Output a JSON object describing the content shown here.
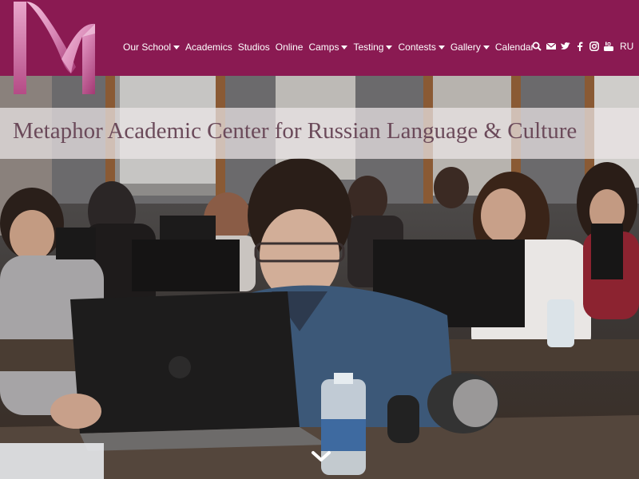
{
  "header": {
    "logo_letter": "M",
    "nav": [
      {
        "label": "Our School",
        "has_dropdown": true
      },
      {
        "label": "Academics",
        "has_dropdown": false
      },
      {
        "label": "Studios",
        "has_dropdown": false
      },
      {
        "label": "Online",
        "has_dropdown": false
      },
      {
        "label": "Camps",
        "has_dropdown": true
      },
      {
        "label": "Testing",
        "has_dropdown": true
      },
      {
        "label": "Contests",
        "has_dropdown": true
      },
      {
        "label": "Gallery",
        "has_dropdown": true
      },
      {
        "label": "Calendar",
        "has_dropdown": false
      }
    ],
    "icons": [
      "search-icon",
      "envelope-icon",
      "twitter-icon",
      "facebook-icon",
      "instagram-icon",
      "youtube-icon"
    ],
    "language": "RU",
    "brand_color": "#8a1a52"
  },
  "hero": {
    "title": "Metaphor Academic Center for Russian Language & Culture",
    "scroll_icon": "chevron-down-icon"
  }
}
